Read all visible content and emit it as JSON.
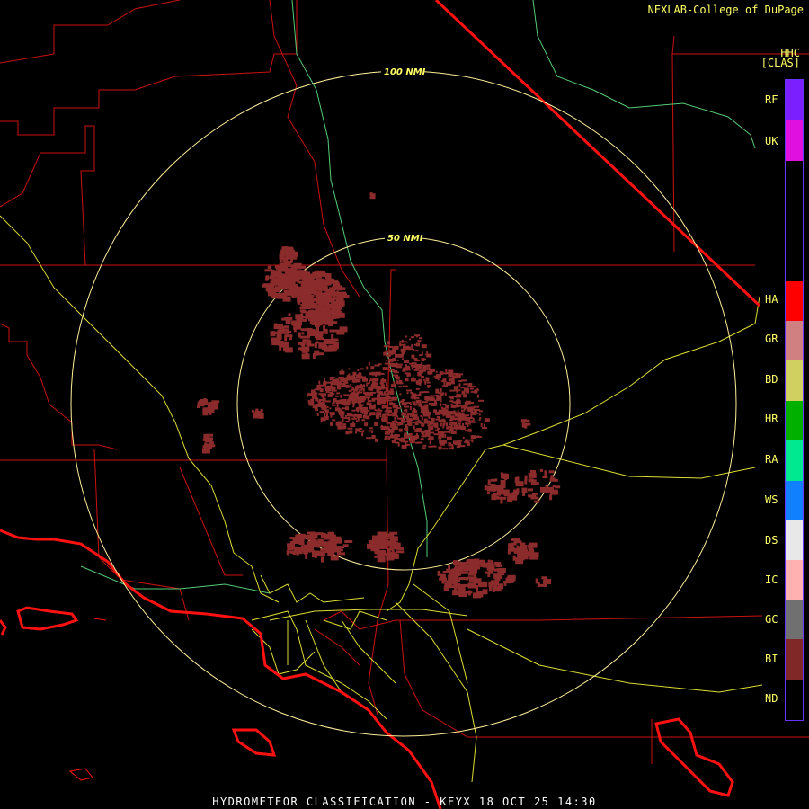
{
  "header": {
    "brand": "NEXLAB-College of DuPage",
    "product": "HHC",
    "product_class": "[CLAS]"
  },
  "footer": {
    "caption": "HYDROMETEOR CLASSIFICATION - KEYX 18 OCT 25 14:30"
  },
  "map": {
    "rings": [
      {
        "label": "100 NMI"
      },
      {
        "label": "50 NMI"
      }
    ],
    "colors": {
      "state_border": "#dd0000",
      "county_line": "#cc1111",
      "highway": "#dddd33",
      "river": "#66dd88",
      "coast": "#ff1111",
      "ring": "#ffee99",
      "echo": "#8b2b2b"
    }
  },
  "legend": {
    "items": [
      {
        "code": "RF",
        "color": "#7b1fff"
      },
      {
        "code": "UK",
        "color": "#e010e0"
      },
      {
        "code": "HA",
        "color": "#ff0000"
      },
      {
        "code": "GR",
        "color": "#d08080"
      },
      {
        "code": "BD",
        "color": "#d0d060"
      },
      {
        "code": "HR",
        "color": "#00b000"
      },
      {
        "code": "RA",
        "color": "#00e890"
      },
      {
        "code": "WS",
        "color": "#1080ff"
      },
      {
        "code": "DS",
        "color": "#e8e8e8"
      },
      {
        "code": "IC",
        "color": "#ffb0b0"
      },
      {
        "code": "GC",
        "color": "#707070"
      },
      {
        "code": "BI",
        "color": "#802828"
      },
      {
        "code": "ND",
        "color": "#000000"
      }
    ]
  }
}
